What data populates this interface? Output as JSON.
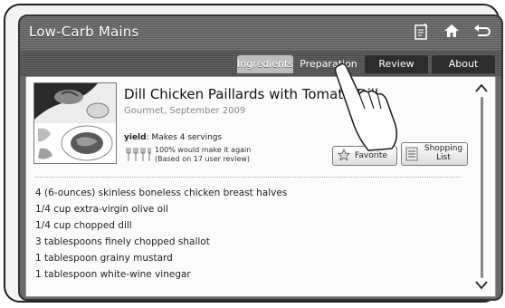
{
  "header": {
    "title": "Low-Carb Mains"
  },
  "icons": {
    "doc": "document-icon",
    "home": "home-icon",
    "back": "back-icon"
  },
  "tabs": [
    {
      "label": "Ingredients",
      "active": true
    },
    {
      "label": "Preparation",
      "active": false
    },
    {
      "label": "Review",
      "active": false
    },
    {
      "label": "About",
      "active": false
    }
  ],
  "recipe": {
    "title": "Dill Chicken Paillards with Tomato-Dill",
    "source": "Gourmet, September 2009",
    "yield_label": "yield",
    "yield_value": ": Makes 4 servings",
    "rating_line1": "100% would make it again",
    "rating_line2": "(Based on 17 user review)"
  },
  "actions": {
    "favorite": "Favorite",
    "shopping_line1": "Shopping",
    "shopping_line2": "List"
  },
  "ingredients": [
    "4 (6-ounces) skinless boneless chicken breast halves",
    "1/4 cup extra-virgin olive oil",
    "1/4 cup chopped dill",
    "3 tablespoons finely chopped shallot",
    "1 tablespoon grainy mustard",
    "1 tablespoon white-wine vinegar"
  ]
}
